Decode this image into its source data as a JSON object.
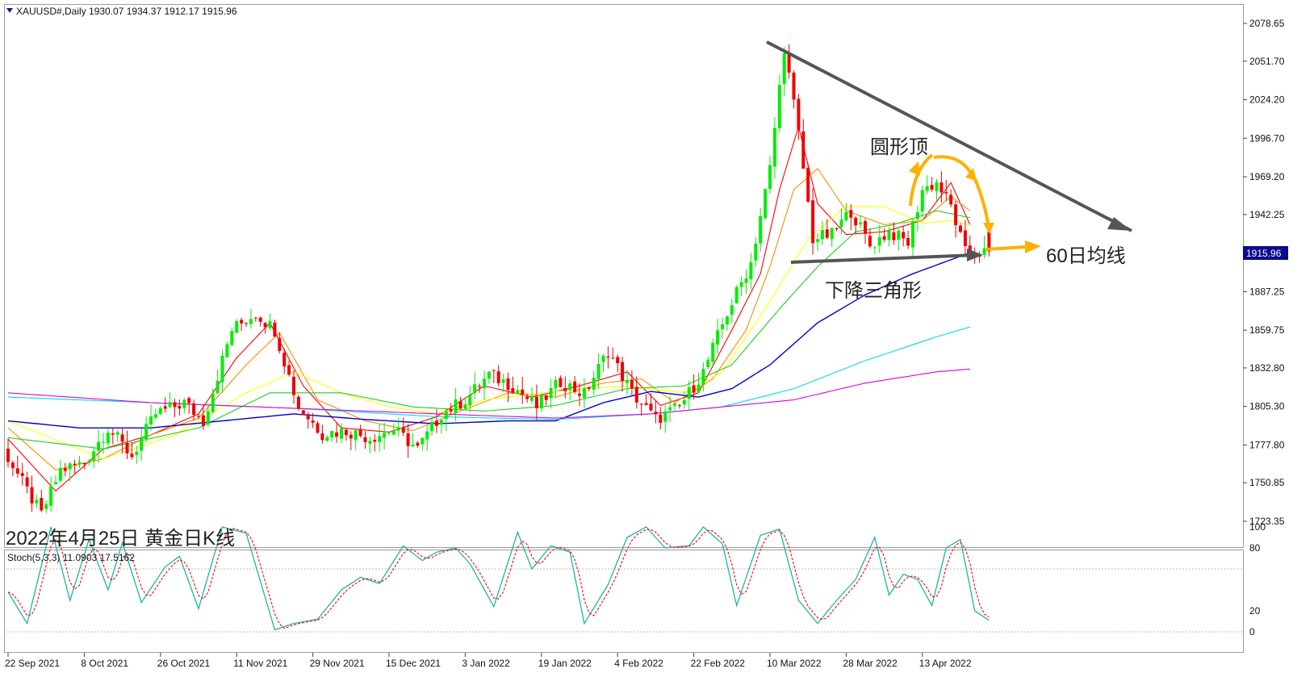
{
  "header": {
    "symbol_line": "XAUUSD#,Daily  1930.07 1934.37 1912.17 1915.96",
    "stoch_line": "Stoch(5,3,3) 11.0903 17.5162"
  },
  "annotations": {
    "rounded_top": "圆形顶",
    "ma60": "60日均线",
    "descending_triangle": "下降三角形",
    "caption": "2022年4月25日 黄金日K线"
  },
  "price_axis": {
    "ticks": [
      "2078.65",
      "2051.70",
      "2024.20",
      "1996.70",
      "1969.20",
      "1942.25",
      "1915.96",
      "1887.25",
      "1859.75",
      "1832.80",
      "1805.30",
      "1777.80",
      "1750.85",
      "1723.35"
    ],
    "current_price": "1915.96",
    "current_price_value": 1915.96
  },
  "stoch_axis": {
    "ticks": [
      "100",
      "80",
      "20",
      "0"
    ]
  },
  "time_axis": {
    "labels": [
      "22 Sep 2021",
      "8 Oct 2021",
      "26 Oct 2021",
      "11 Nov 2021",
      "29 Nov 2021",
      "15 Dec 2021",
      "3 Jan 2022",
      "19 Jan 2022",
      "4 Feb 2022",
      "22 Feb 2022",
      "10 Mar 2022",
      "28 Mar 2022",
      "13 Apr 2022"
    ]
  },
  "colors": {
    "bull": "#00ee00",
    "bear": "#ee0000",
    "ma5": "#ff0000",
    "ma10": "#ff8c00",
    "ma20": "#ffff00",
    "ma30": "#22cc22",
    "ma60": "#0000cc",
    "ma120": "#00dddd",
    "ma250": "#dd00dd",
    "stoch_main": "#20b2aa",
    "stoch_signal": "#ff0000",
    "annotation_arrow": "#ffb000",
    "trendline": "#444444"
  },
  "chart_data": {
    "type": "candlestick",
    "title": "XAUUSD#,Daily",
    "ylim": [
      1710,
      2090
    ],
    "last_bar": {
      "open": 1930.07,
      "high": 1934.37,
      "low": 1912.17,
      "close": 1915.96
    },
    "price_path": [
      [
        0,
        1775
      ],
      [
        5,
        1745
      ],
      [
        8,
        1728
      ],
      [
        12,
        1760
      ],
      [
        17,
        1765
      ],
      [
        22,
        1790
      ],
      [
        27,
        1770
      ],
      [
        32,
        1800
      ],
      [
        38,
        1808
      ],
      [
        42,
        1795
      ],
      [
        48,
        1860
      ],
      [
        53,
        1872
      ],
      [
        57,
        1860
      ],
      [
        62,
        1805
      ],
      [
        67,
        1786
      ],
      [
        72,
        1788
      ],
      [
        77,
        1783
      ],
      [
        82,
        1789
      ],
      [
        87,
        1775
      ],
      [
        92,
        1800
      ],
      [
        97,
        1810
      ],
      [
        102,
        1828
      ],
      [
        107,
        1820
      ],
      [
        112,
        1805
      ],
      [
        117,
        1823
      ],
      [
        122,
        1814
      ],
      [
        127,
        1845
      ],
      [
        132,
        1815
      ],
      [
        137,
        1796
      ],
      [
        142,
        1805
      ],
      [
        147,
        1830
      ],
      [
        152,
        1872
      ],
      [
        157,
        1908
      ],
      [
        161,
        1975
      ],
      [
        164,
        2062
      ],
      [
        167,
        2000
      ],
      [
        170,
        1925
      ],
      [
        174,
        1928
      ],
      [
        178,
        1945
      ],
      [
        182,
        1920
      ],
      [
        186,
        1930
      ],
      [
        190,
        1922
      ],
      [
        193,
        1960
      ],
      [
        196,
        1965
      ],
      [
        199,
        1948
      ],
      [
        202,
        1915
      ]
    ],
    "stoch_main": [
      [
        0,
        38
      ],
      [
        4,
        8
      ],
      [
        9,
        100
      ],
      [
        13,
        30
      ],
      [
        17,
        88
      ],
      [
        21,
        40
      ],
      [
        24,
        85
      ],
      [
        28,
        28
      ],
      [
        33,
        62
      ],
      [
        36,
        72
      ],
      [
        40,
        22
      ],
      [
        45,
        100
      ],
      [
        50,
        94
      ],
      [
        56,
        2
      ],
      [
        60,
        8
      ],
      [
        65,
        12
      ],
      [
        70,
        40
      ],
      [
        74,
        52
      ],
      [
        78,
        46
      ],
      [
        83,
        82
      ],
      [
        87,
        68
      ],
      [
        90,
        76
      ],
      [
        94,
        80
      ],
      [
        97,
        65
      ],
      [
        102,
        24
      ],
      [
        107,
        95
      ],
      [
        110,
        60
      ],
      [
        114,
        82
      ],
      [
        118,
        76
      ],
      [
        121,
        8
      ],
      [
        126,
        45
      ],
      [
        130,
        90
      ],
      [
        134,
        100
      ],
      [
        138,
        80
      ],
      [
        143,
        82
      ],
      [
        146,
        100
      ],
      [
        150,
        84
      ],
      [
        153,
        25
      ],
      [
        158,
        92
      ],
      [
        162,
        98
      ],
      [
        166,
        30
      ],
      [
        170,
        8
      ],
      [
        174,
        30
      ],
      [
        178,
        50
      ],
      [
        182,
        90
      ],
      [
        185,
        35
      ],
      [
        188,
        55
      ],
      [
        191,
        50
      ],
      [
        194,
        25
      ],
      [
        197,
        80
      ],
      [
        200,
        88
      ],
      [
        203,
        20
      ],
      [
        206,
        11
      ]
    ],
    "moving_averages": [
      {
        "name": "MA5",
        "path": [
          [
            0,
            1782
          ],
          [
            10,
            1745
          ],
          [
            20,
            1775
          ],
          [
            30,
            1785
          ],
          [
            40,
            1800
          ],
          [
            48,
            1840
          ],
          [
            55,
            1865
          ],
          [
            62,
            1820
          ],
          [
            70,
            1790
          ],
          [
            80,
            1787
          ],
          [
            90,
            1798
          ],
          [
            100,
            1820
          ],
          [
            110,
            1812
          ],
          [
            120,
            1820
          ],
          [
            130,
            1830
          ],
          [
            137,
            1806
          ],
          [
            145,
            1815
          ],
          [
            152,
            1860
          ],
          [
            158,
            1900
          ],
          [
            162,
            1960
          ],
          [
            166,
            2005
          ],
          [
            170,
            1950
          ],
          [
            176,
            1928
          ],
          [
            184,
            1930
          ],
          [
            192,
            1938
          ],
          [
            198,
            1965
          ],
          [
            202,
            1935
          ]
        ]
      },
      {
        "name": "MA10",
        "path": [
          [
            0,
            1790
          ],
          [
            10,
            1760
          ],
          [
            20,
            1768
          ],
          [
            30,
            1785
          ],
          [
            40,
            1797
          ],
          [
            50,
            1835
          ],
          [
            57,
            1858
          ],
          [
            65,
            1810
          ],
          [
            75,
            1795
          ],
          [
            85,
            1788
          ],
          [
            95,
            1802
          ],
          [
            105,
            1815
          ],
          [
            115,
            1812
          ],
          [
            125,
            1822
          ],
          [
            133,
            1825
          ],
          [
            140,
            1808
          ],
          [
            148,
            1825
          ],
          [
            155,
            1860
          ],
          [
            160,
            1905
          ],
          [
            165,
            1960
          ],
          [
            170,
            1975
          ],
          [
            176,
            1945
          ],
          [
            184,
            1935
          ],
          [
            192,
            1938
          ],
          [
            198,
            1955
          ],
          [
            202,
            1945
          ]
        ]
      },
      {
        "name": "MA20",
        "path": [
          [
            0,
            1795
          ],
          [
            20,
            1768
          ],
          [
            35,
            1785
          ],
          [
            50,
            1815
          ],
          [
            60,
            1830
          ],
          [
            70,
            1815
          ],
          [
            80,
            1805
          ],
          [
            90,
            1800
          ],
          [
            100,
            1810
          ],
          [
            115,
            1816
          ],
          [
            130,
            1820
          ],
          [
            142,
            1815
          ],
          [
            150,
            1830
          ],
          [
            160,
            1880
          ],
          [
            168,
            1925
          ],
          [
            176,
            1948
          ],
          [
            184,
            1948
          ],
          [
            192,
            1936
          ],
          [
            198,
            1938
          ],
          [
            202,
            1935
          ]
        ]
      },
      {
        "name": "MA30",
        "path": [
          [
            0,
            1783
          ],
          [
            20,
            1775
          ],
          [
            40,
            1790
          ],
          [
            55,
            1815
          ],
          [
            70,
            1815
          ],
          [
            85,
            1805
          ],
          [
            100,
            1802
          ],
          [
            115,
            1806
          ],
          [
            130,
            1818
          ],
          [
            142,
            1820
          ],
          [
            152,
            1835
          ],
          [
            162,
            1875
          ],
          [
            170,
            1905
          ],
          [
            178,
            1930
          ],
          [
            186,
            1935
          ],
          [
            195,
            1945
          ],
          [
            202,
            1940
          ]
        ]
      },
      {
        "name": "MA60",
        "path": [
          [
            0,
            1795
          ],
          [
            15,
            1790
          ],
          [
            30,
            1790
          ],
          [
            45,
            1795
          ],
          [
            60,
            1800
          ],
          [
            75,
            1796
          ],
          [
            90,
            1793
          ],
          [
            105,
            1795
          ],
          [
            115,
            1795
          ],
          [
            125,
            1808
          ],
          [
            135,
            1816
          ],
          [
            145,
            1812
          ],
          [
            152,
            1818
          ],
          [
            160,
            1835
          ],
          [
            170,
            1865
          ],
          [
            180,
            1885
          ],
          [
            190,
            1900
          ],
          [
            202,
            1915
          ]
        ]
      },
      {
        "name": "MA120",
        "path": [
          [
            0,
            1812
          ],
          [
            30,
            1808
          ],
          [
            60,
            1804
          ],
          [
            90,
            1798
          ],
          [
            115,
            1796
          ],
          [
            135,
            1800
          ],
          [
            150,
            1805
          ],
          [
            165,
            1818
          ],
          [
            180,
            1838
          ],
          [
            195,
            1855
          ],
          [
            202,
            1862
          ]
        ]
      },
      {
        "name": "MA250",
        "path": [
          [
            0,
            1815
          ],
          [
            30,
            1808
          ],
          [
            60,
            1804
          ],
          [
            90,
            1800
          ],
          [
            115,
            1797
          ],
          [
            135,
            1800
          ],
          [
            150,
            1805
          ],
          [
            165,
            1810
          ],
          [
            180,
            1822
          ],
          [
            195,
            1830
          ],
          [
            202,
            1832
          ]
        ]
      }
    ]
  }
}
